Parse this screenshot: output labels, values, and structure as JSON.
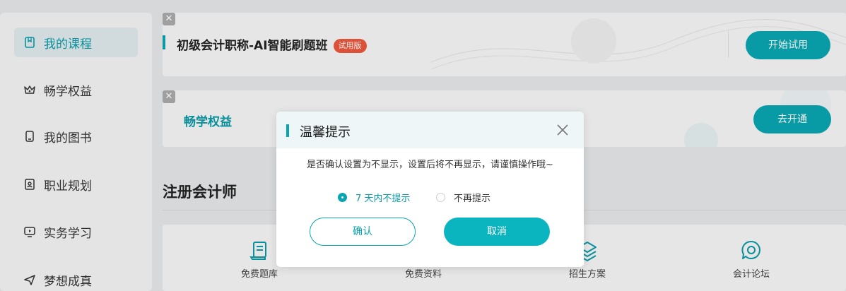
{
  "sidebar": {
    "items": [
      {
        "label": "我的课程",
        "icon": "book-icon",
        "active": true
      },
      {
        "label": "畅学权益",
        "icon": "crown-icon"
      },
      {
        "label": "我的图书",
        "icon": "phone-book-icon"
      },
      {
        "label": "职业规划",
        "icon": "badge-icon"
      },
      {
        "label": "实务学习",
        "icon": "monitor-play-icon"
      },
      {
        "label": "梦想成真",
        "icon": "paper-plane-icon"
      }
    ]
  },
  "course_card": {
    "title": "初级会计职称-AI智能刷题班",
    "tag": "试用版",
    "button": "开始试用"
  },
  "benefit_card": {
    "title": "畅学权益",
    "button": "去开通"
  },
  "section": {
    "title": "注册会计师"
  },
  "tools": [
    {
      "label": "免费题库",
      "icon": "question-bank-icon"
    },
    {
      "label": "免费资料",
      "icon": "materials-icon"
    },
    {
      "label": "招生方案",
      "icon": "layers-icon"
    },
    {
      "label": "会计论坛",
      "icon": "forum-icon"
    }
  ],
  "dialog": {
    "title": "温馨提示",
    "message": "是否确认设置为不显示，设置后将不再显示，请谨慎操作哦~",
    "options": [
      "7 天内不提示",
      "不再提示"
    ],
    "selected_option": "7 天内不提示",
    "confirm_label": "确认",
    "cancel_label": "取消"
  },
  "colors": {
    "accent": "#0aa5b0",
    "tag": "#e9583d",
    "background": "#e4e6e8"
  }
}
